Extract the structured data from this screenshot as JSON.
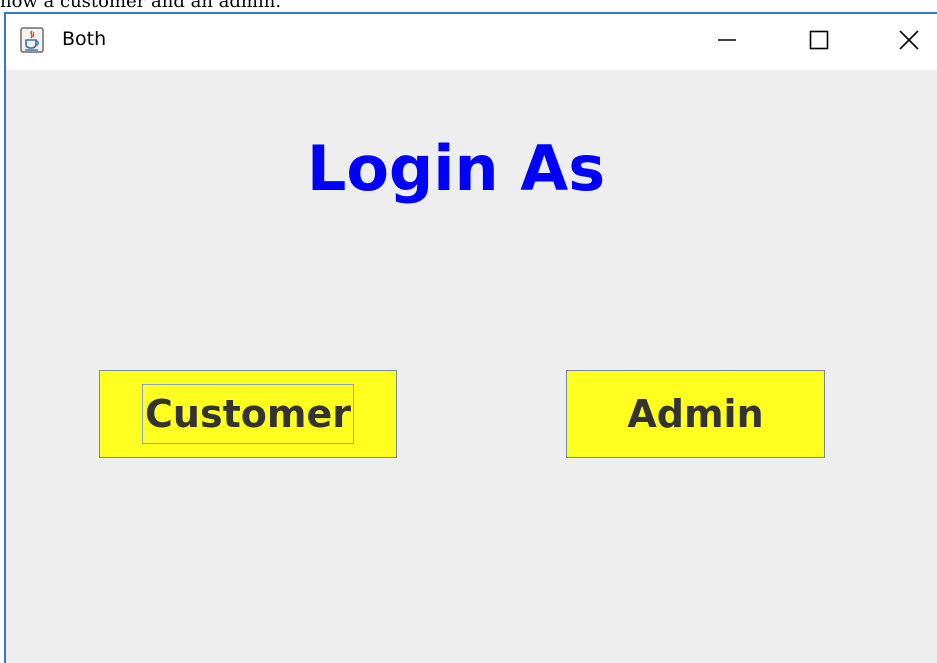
{
  "background_caption": "how a customer and an admin.",
  "window": {
    "title": "Both",
    "controls": {
      "minimize": "minimize",
      "maximize": "maximize",
      "close": "close"
    }
  },
  "content": {
    "heading": "Login As",
    "buttons": {
      "customer_label": "Customer",
      "admin_label": "Admin"
    }
  },
  "colors": {
    "heading": "#0000ff",
    "button_background": "#ffff1f",
    "button_text": "#333333",
    "window_background": "#eeeeee",
    "window_border": "#2b7bd6"
  },
  "icons": {
    "app_icon": "java-coffee-cup-icon",
    "minimize_icon": "minimize-icon",
    "maximize_icon": "maximize-icon",
    "close_icon": "close-icon"
  }
}
